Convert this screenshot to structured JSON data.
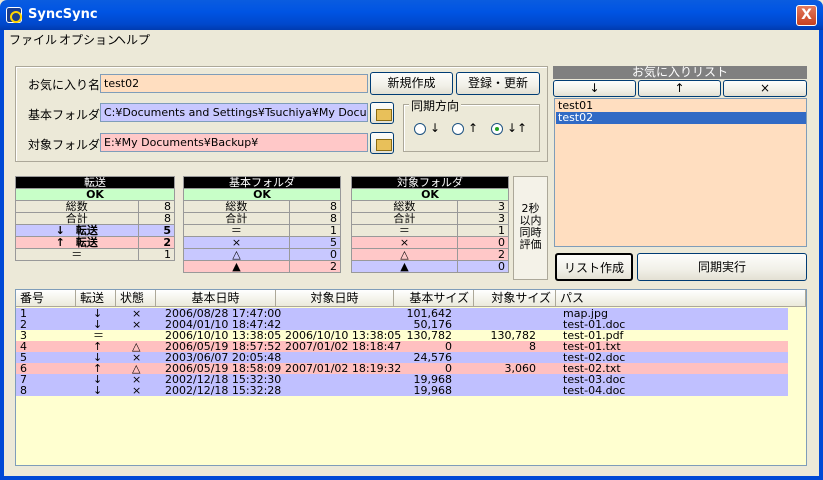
{
  "window": {
    "title": "SyncSync",
    "close_glyph": "X"
  },
  "menu": [
    "ファイル",
    "オプション",
    "ヘルプ"
  ],
  "form": {
    "fav_name_label": "お気に入り名",
    "fav_name_value": "test02",
    "base_folder_label": "基本フォルダ",
    "base_folder_value": "C:¥Documents and Settings¥Tsuchiya¥My Documents",
    "target_folder_label": "対象フォルダ",
    "target_folder_value": "E:¥My Documents¥Backup¥",
    "new_button": "新規作成",
    "register_button": "登録・更新"
  },
  "sync_direction": {
    "title": "同期方向",
    "options": [
      "↓",
      "↑",
      "↓↑"
    ],
    "selected_index": 2
  },
  "favorites": {
    "title": "お気に入りリスト",
    "down_button": "↓",
    "up_button": "↑",
    "delete_button": "×",
    "items": [
      "test01",
      "test02"
    ],
    "selected_index": 1
  },
  "stats": {
    "transfer": {
      "title": "転送",
      "status": "OK",
      "rows": [
        {
          "label": "総数",
          "value": "8"
        },
        {
          "label": "合計",
          "value": "8"
        },
        {
          "label": "↓　転送",
          "value": "5"
        },
        {
          "label": "↑　転送",
          "value": "2"
        },
        {
          "label": "＝",
          "value": "1"
        }
      ]
    },
    "base": {
      "title": "基本フォルダ",
      "status": "OK",
      "rows": [
        {
          "label": "総数",
          "value": "8"
        },
        {
          "label": "合計",
          "value": "8"
        },
        {
          "label": "＝",
          "value": "1"
        },
        {
          "label": "×",
          "value": "5"
        },
        {
          "label": "△",
          "value": "0"
        },
        {
          "label": "▲",
          "value": "2"
        }
      ]
    },
    "target": {
      "title": "対象フォルダ",
      "status": "OK",
      "rows": [
        {
          "label": "総数",
          "value": "3"
        },
        {
          "label": "合計",
          "value": "3"
        },
        {
          "label": "＝",
          "value": "1"
        },
        {
          "label": "×",
          "value": "0"
        },
        {
          "label": "△",
          "value": "2"
        },
        {
          "label": "▲",
          "value": "0"
        }
      ]
    },
    "note": "2秒\n以内\n同時\n評価"
  },
  "actions": {
    "list_button": "リスト作成",
    "sync_button": "同期実行"
  },
  "table": {
    "headers": [
      "番号",
      "転送",
      "状態",
      "基本日時",
      "対象日時",
      "基本サイズ",
      "対象サイズ",
      "パス"
    ],
    "rows": [
      {
        "no": "1",
        "transfer": "↓",
        "state": "×",
        "base_date": "2006/08/28 17:47:00",
        "target_date": "",
        "base_size": "101,642",
        "target_size": "",
        "path": "map.jpg",
        "color": "blue"
      },
      {
        "no": "2",
        "transfer": "↓",
        "state": "×",
        "base_date": "2004/01/10 18:47:42",
        "target_date": "",
        "base_size": "50,176",
        "target_size": "",
        "path": "test-01.doc",
        "color": "blue"
      },
      {
        "no": "3",
        "transfer": "＝",
        "state": "",
        "base_date": "2006/10/10 13:38:05",
        "target_date": "2006/10/10 13:38:05",
        "base_size": "130,782",
        "target_size": "130,782",
        "path": "test-01.pdf",
        "color": "yellow"
      },
      {
        "no": "4",
        "transfer": "↑",
        "state": "△",
        "base_date": "2006/05/19 18:57:52",
        "target_date": "2007/01/02 18:18:47",
        "base_size": "0",
        "target_size": "8",
        "path": "test-01.txt",
        "color": "pink"
      },
      {
        "no": "5",
        "transfer": "↓",
        "state": "×",
        "base_date": "2003/06/07 20:05:48",
        "target_date": "",
        "base_size": "24,576",
        "target_size": "",
        "path": "test-02.doc",
        "color": "blue"
      },
      {
        "no": "6",
        "transfer": "↑",
        "state": "△",
        "base_date": "2006/05/19 18:58:09",
        "target_date": "2007/01/02 18:19:32",
        "base_size": "0",
        "target_size": "3,060",
        "path": "test-02.txt",
        "color": "pink"
      },
      {
        "no": "7",
        "transfer": "↓",
        "state": "×",
        "base_date": "2002/12/18 15:32:30",
        "target_date": "",
        "base_size": "19,968",
        "target_size": "",
        "path": "test-03.doc",
        "color": "blue"
      },
      {
        "no": "8",
        "transfer": "↓",
        "state": "×",
        "base_date": "2002/12/18 15:32:28",
        "target_date": "",
        "base_size": "19,968",
        "target_size": "",
        "path": "test-04.doc",
        "color": "blue"
      }
    ]
  },
  "colors": {
    "titlebar": "#0054e3",
    "blue_row": "#c0c0ff",
    "pink_row": "#ffc0c0",
    "list_bg": "#ffffd0",
    "fav_bg": "#ffdec0"
  }
}
